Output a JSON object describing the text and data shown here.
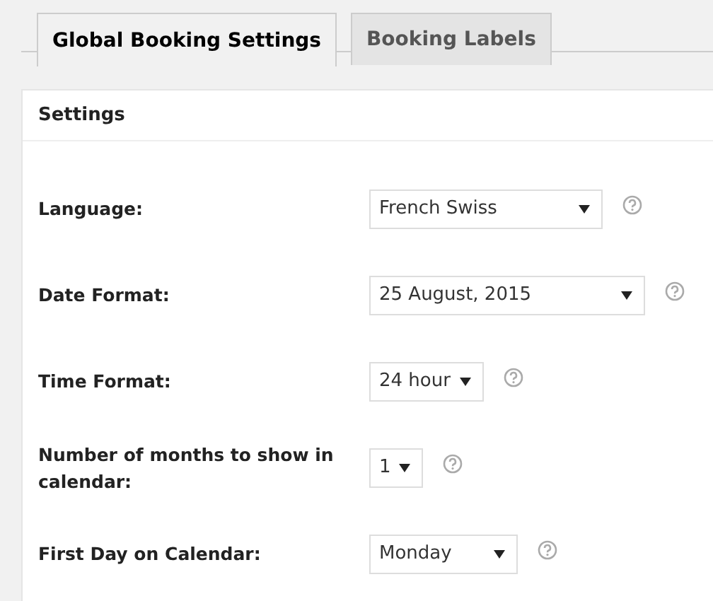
{
  "tabs": [
    {
      "label": "Global Booking Settings",
      "selected": true
    },
    {
      "label": "Booking Labels",
      "selected": false
    }
  ],
  "panel": {
    "title": "Settings"
  },
  "settings": [
    {
      "label": "Language:",
      "value": "French Swiss"
    },
    {
      "label": "Date Format:",
      "value": "25 August, 2015"
    },
    {
      "label": "Time Format:",
      "value": "24 hour"
    },
    {
      "label": "Number of months to show in calendar:",
      "value": "1"
    },
    {
      "label": "First Day on Calendar:",
      "value": "Monday"
    }
  ]
}
